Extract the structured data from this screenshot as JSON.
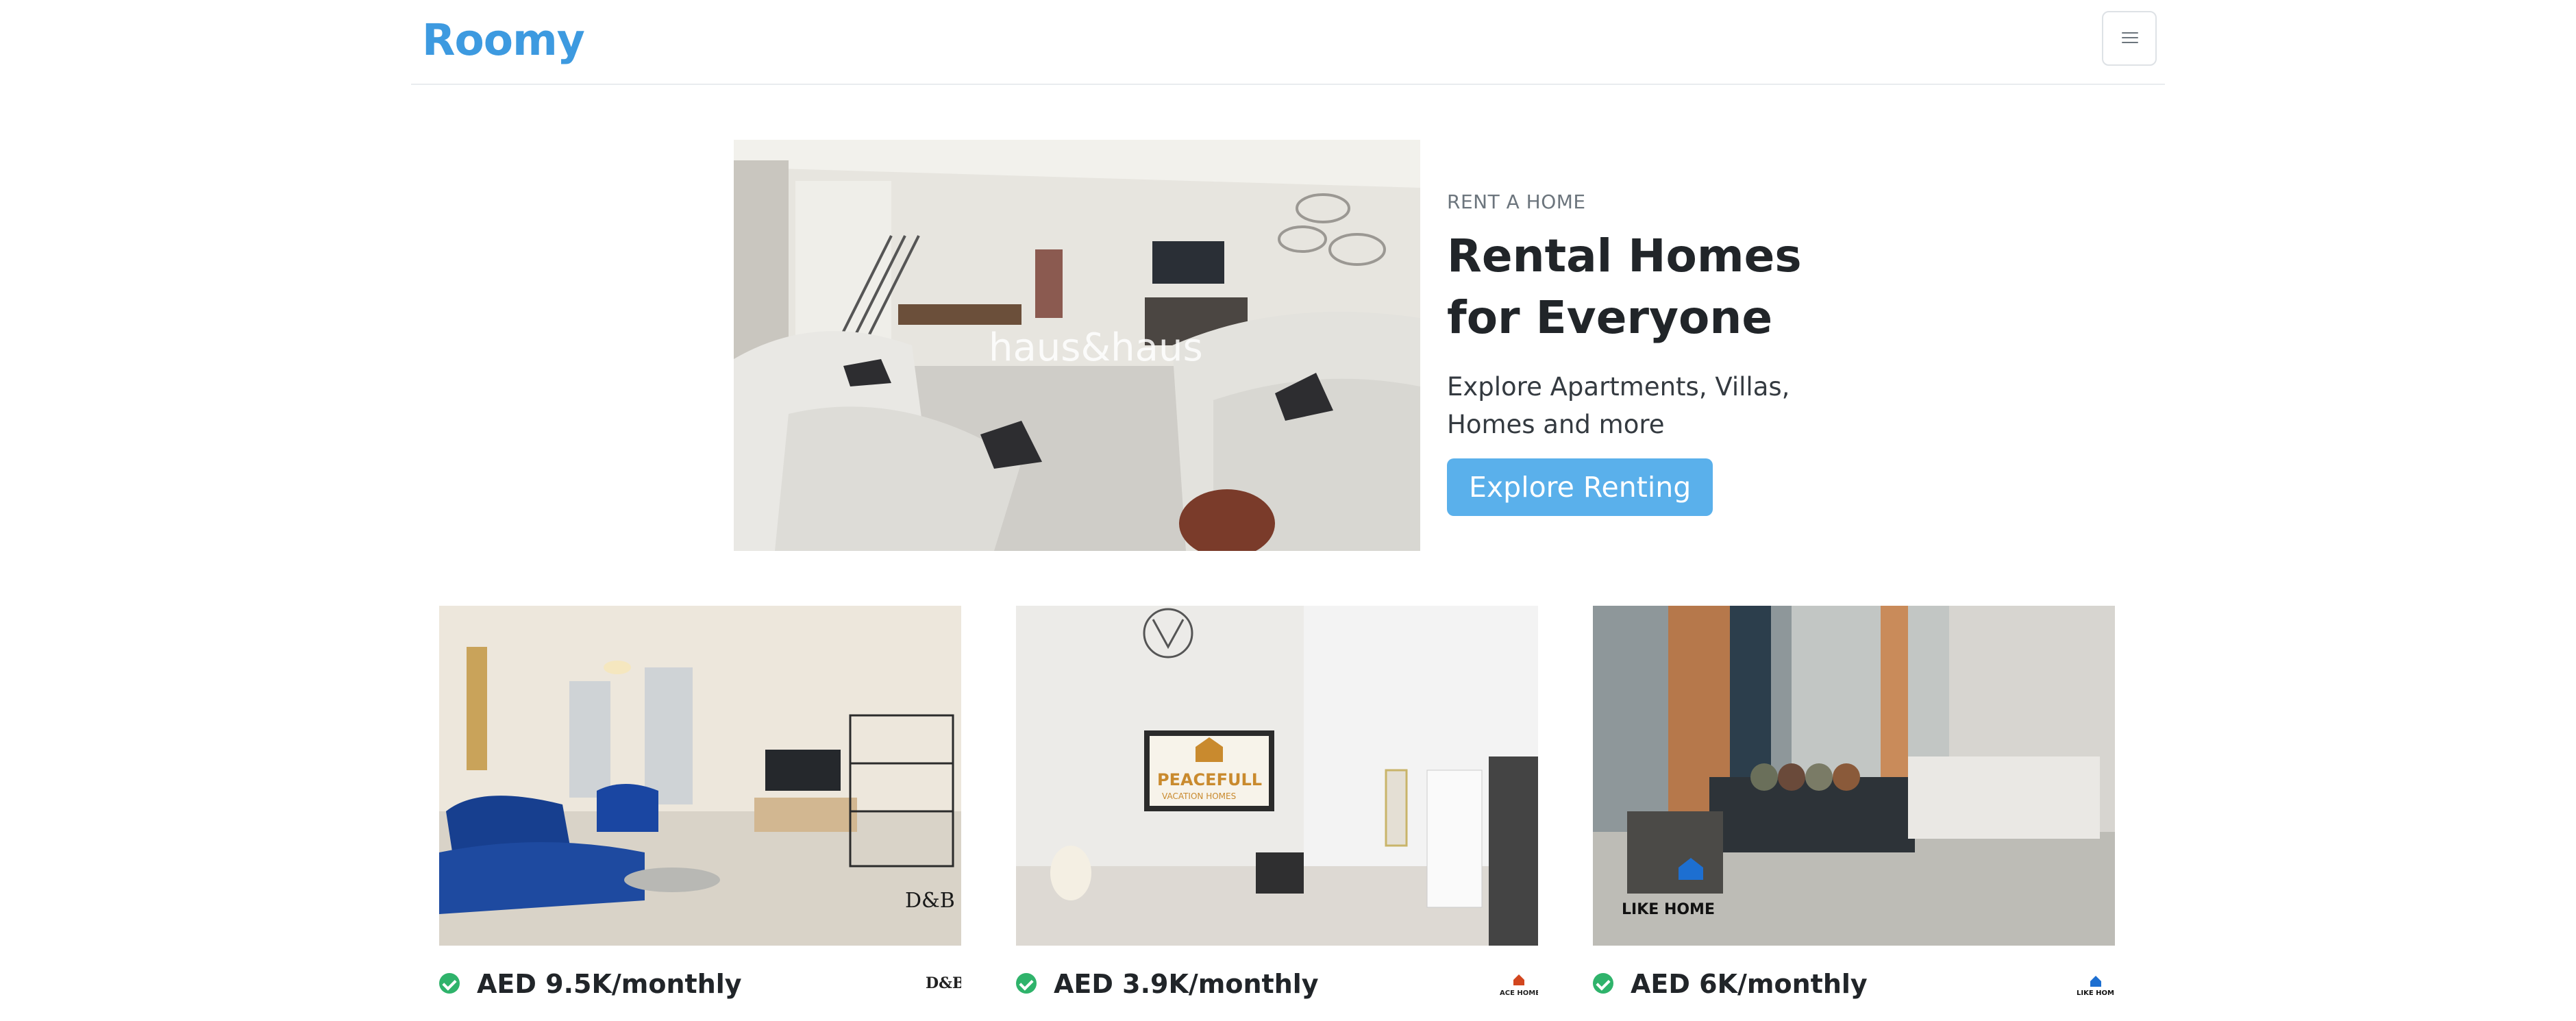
{
  "navbar": {
    "brand": "Roomy",
    "menu_icon": "hamburger-icon"
  },
  "hero": {
    "eyebrow": "RENT A HOME",
    "title": "Rental Homes for Everyone",
    "subtitle": "Explore Apartments, Villas, Homes and more",
    "cta": "Explore Renting",
    "watermark": "haus&haus"
  },
  "listings": [
    {
      "price": "AED 9.5K/monthly",
      "agency_logo_text": "D&B",
      "verified_icon": "check-circle-icon"
    },
    {
      "price": "AED 3.9K/monthly",
      "agency_logo_text": "ACE HOME",
      "verified_icon": "check-circle-icon",
      "tv_text_1": "PEACEFULL",
      "tv_text_2": "VACATION HOMES"
    },
    {
      "price": "AED 6K/monthly",
      "agency_logo_text": "LIKE HOME",
      "verified_icon": "check-circle-icon"
    }
  ],
  "colors": {
    "brand": "#3d9ae0",
    "cta": "#5ab0eb",
    "verified": "#2fb36b"
  }
}
